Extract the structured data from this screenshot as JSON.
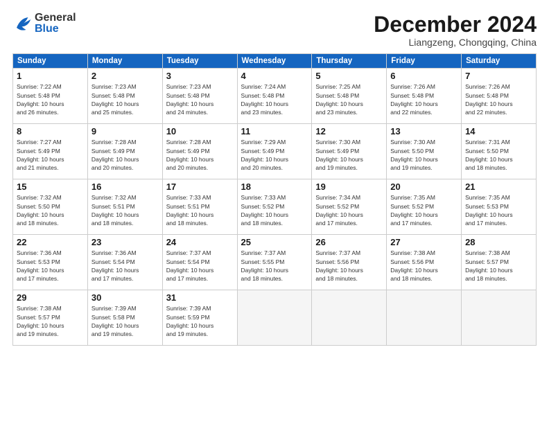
{
  "header": {
    "logo_general": "General",
    "logo_blue": "Blue",
    "month_title": "December 2024",
    "location": "Liangzeng, Chongqing, China"
  },
  "weekdays": [
    "Sunday",
    "Monday",
    "Tuesday",
    "Wednesday",
    "Thursday",
    "Friday",
    "Saturday"
  ],
  "weeks": [
    [
      {
        "day": "1",
        "info": "Sunrise: 7:22 AM\nSunset: 5:48 PM\nDaylight: 10 hours\nand 26 minutes."
      },
      {
        "day": "2",
        "info": "Sunrise: 7:23 AM\nSunset: 5:48 PM\nDaylight: 10 hours\nand 25 minutes."
      },
      {
        "day": "3",
        "info": "Sunrise: 7:23 AM\nSunset: 5:48 PM\nDaylight: 10 hours\nand 24 minutes."
      },
      {
        "day": "4",
        "info": "Sunrise: 7:24 AM\nSunset: 5:48 PM\nDaylight: 10 hours\nand 23 minutes."
      },
      {
        "day": "5",
        "info": "Sunrise: 7:25 AM\nSunset: 5:48 PM\nDaylight: 10 hours\nand 23 minutes."
      },
      {
        "day": "6",
        "info": "Sunrise: 7:26 AM\nSunset: 5:48 PM\nDaylight: 10 hours\nand 22 minutes."
      },
      {
        "day": "7",
        "info": "Sunrise: 7:26 AM\nSunset: 5:48 PM\nDaylight: 10 hours\nand 22 minutes."
      }
    ],
    [
      {
        "day": "8",
        "info": "Sunrise: 7:27 AM\nSunset: 5:49 PM\nDaylight: 10 hours\nand 21 minutes."
      },
      {
        "day": "9",
        "info": "Sunrise: 7:28 AM\nSunset: 5:49 PM\nDaylight: 10 hours\nand 20 minutes."
      },
      {
        "day": "10",
        "info": "Sunrise: 7:28 AM\nSunset: 5:49 PM\nDaylight: 10 hours\nand 20 minutes."
      },
      {
        "day": "11",
        "info": "Sunrise: 7:29 AM\nSunset: 5:49 PM\nDaylight: 10 hours\nand 20 minutes."
      },
      {
        "day": "12",
        "info": "Sunrise: 7:30 AM\nSunset: 5:49 PM\nDaylight: 10 hours\nand 19 minutes."
      },
      {
        "day": "13",
        "info": "Sunrise: 7:30 AM\nSunset: 5:50 PM\nDaylight: 10 hours\nand 19 minutes."
      },
      {
        "day": "14",
        "info": "Sunrise: 7:31 AM\nSunset: 5:50 PM\nDaylight: 10 hours\nand 18 minutes."
      }
    ],
    [
      {
        "day": "15",
        "info": "Sunrise: 7:32 AM\nSunset: 5:50 PM\nDaylight: 10 hours\nand 18 minutes."
      },
      {
        "day": "16",
        "info": "Sunrise: 7:32 AM\nSunset: 5:51 PM\nDaylight: 10 hours\nand 18 minutes."
      },
      {
        "day": "17",
        "info": "Sunrise: 7:33 AM\nSunset: 5:51 PM\nDaylight: 10 hours\nand 18 minutes."
      },
      {
        "day": "18",
        "info": "Sunrise: 7:33 AM\nSunset: 5:52 PM\nDaylight: 10 hours\nand 18 minutes."
      },
      {
        "day": "19",
        "info": "Sunrise: 7:34 AM\nSunset: 5:52 PM\nDaylight: 10 hours\nand 17 minutes."
      },
      {
        "day": "20",
        "info": "Sunrise: 7:35 AM\nSunset: 5:52 PM\nDaylight: 10 hours\nand 17 minutes."
      },
      {
        "day": "21",
        "info": "Sunrise: 7:35 AM\nSunset: 5:53 PM\nDaylight: 10 hours\nand 17 minutes."
      }
    ],
    [
      {
        "day": "22",
        "info": "Sunrise: 7:36 AM\nSunset: 5:53 PM\nDaylight: 10 hours\nand 17 minutes."
      },
      {
        "day": "23",
        "info": "Sunrise: 7:36 AM\nSunset: 5:54 PM\nDaylight: 10 hours\nand 17 minutes."
      },
      {
        "day": "24",
        "info": "Sunrise: 7:37 AM\nSunset: 5:54 PM\nDaylight: 10 hours\nand 17 minutes."
      },
      {
        "day": "25",
        "info": "Sunrise: 7:37 AM\nSunset: 5:55 PM\nDaylight: 10 hours\nand 18 minutes."
      },
      {
        "day": "26",
        "info": "Sunrise: 7:37 AM\nSunset: 5:56 PM\nDaylight: 10 hours\nand 18 minutes."
      },
      {
        "day": "27",
        "info": "Sunrise: 7:38 AM\nSunset: 5:56 PM\nDaylight: 10 hours\nand 18 minutes."
      },
      {
        "day": "28",
        "info": "Sunrise: 7:38 AM\nSunset: 5:57 PM\nDaylight: 10 hours\nand 18 minutes."
      }
    ],
    [
      {
        "day": "29",
        "info": "Sunrise: 7:38 AM\nSunset: 5:57 PM\nDaylight: 10 hours\nand 19 minutes."
      },
      {
        "day": "30",
        "info": "Sunrise: 7:39 AM\nSunset: 5:58 PM\nDaylight: 10 hours\nand 19 minutes."
      },
      {
        "day": "31",
        "info": "Sunrise: 7:39 AM\nSunset: 5:59 PM\nDaylight: 10 hours\nand 19 minutes."
      },
      {
        "day": "",
        "info": ""
      },
      {
        "day": "",
        "info": ""
      },
      {
        "day": "",
        "info": ""
      },
      {
        "day": "",
        "info": ""
      }
    ]
  ]
}
